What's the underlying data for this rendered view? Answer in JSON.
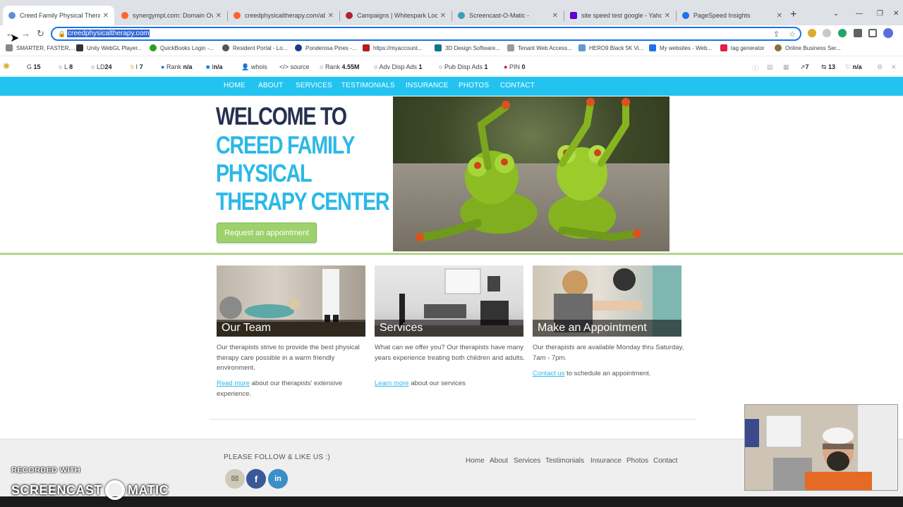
{
  "browser": {
    "tabs": [
      {
        "title": "Creed Family Physical Therapy C",
        "icon_color": "#5f8fd8",
        "active": true
      },
      {
        "title": "synergympt.com: Domain Overv",
        "icon_color": "#ff642d",
        "active": false
      },
      {
        "title": "creedphysicaltherapy.com/abou",
        "icon_color": "#ff642d",
        "active": false
      },
      {
        "title": "Campaigns | Whitespark Local C",
        "icon_color": "#b22234",
        "active": false
      },
      {
        "title": "Screencast-O-Matic -",
        "icon_color": "#3aa0b8",
        "active": false
      },
      {
        "title": "site speed test google - Yahoo S",
        "icon_color": "#6001d2",
        "active": false
      },
      {
        "title": "PageSpeed Insights",
        "icon_color": "#1a73e8",
        "active": false
      }
    ],
    "url": "creedphysicaltherapy.com",
    "bookmarks": [
      {
        "label": "SMARTER, FASTER,...",
        "color": "#888888"
      },
      {
        "label": "Unity WebGL Player...",
        "color": "#333333"
      },
      {
        "label": "QuickBooks Login -...",
        "color": "#2ca01c"
      },
      {
        "label": "Resident Portal - Lo...",
        "color": "#555555"
      },
      {
        "label": "Ponderosa Pines -...",
        "color": "#1e3a8a"
      },
      {
        "label": "https://myaccount...",
        "color": "#b91c1c"
      },
      {
        "label": "3D Design Software...",
        "color": "#0e7490"
      },
      {
        "label": "Tenant Web Access...",
        "color": "#999999"
      },
      {
        "label": "HERO9 Black 5K Vi...",
        "color": "#5b9bd5"
      },
      {
        "label": "My websites - Web...",
        "color": "#1a73e8"
      },
      {
        "label": "tag generator",
        "color": "#e11d48"
      },
      {
        "label": "Online Business Ser...",
        "color": "#8b6f3c"
      }
    ]
  },
  "seo_toolbar": [
    {
      "label": "G",
      "value": "15"
    },
    {
      "label": "L",
      "value": "8"
    },
    {
      "label": "LD",
      "value": "24"
    },
    {
      "label": "I",
      "value": "7"
    },
    {
      "label": "Rank",
      "value": "n/a"
    },
    {
      "label": "I",
      "value": "n/a"
    },
    {
      "label": "whois",
      "value": ""
    },
    {
      "label": "source",
      "value": ""
    },
    {
      "label": "Rank",
      "value": "4.55M"
    },
    {
      "label": "Adv Disp Ads",
      "value": "1"
    },
    {
      "label": "Pub Disp Ads",
      "value": "1"
    },
    {
      "label": "PIN",
      "value": "0"
    },
    {
      "label": "",
      "value": "7"
    },
    {
      "label": "",
      "value": "13"
    },
    {
      "label": "",
      "value": "n/a"
    }
  ],
  "site": {
    "nav": [
      "HOME",
      "ABOUT",
      "SERVICES",
      "TESTIMONIALS",
      "INSURANCE",
      "PHOTOS",
      "CONTACT"
    ],
    "hero": {
      "line1": "WELCOME TO",
      "line2": "CREED FAMILY",
      "line3": "PHYSICAL",
      "line4": "THERAPY CENTER",
      "button": "Request an appointment"
    },
    "cards": [
      {
        "caption": "Our Team",
        "text": "Our therapists strive to provide the best physical therapy care possible in a warm friendly environment.",
        "link": "Read more",
        "after_link": " about our therapists' extensive experience."
      },
      {
        "caption": "Services",
        "text": "What can we offer you? Our therapists have many years experience treating both children and adults.",
        "link": "Learn more",
        "after_link": " about our services"
      },
      {
        "caption": "Make an Appointment",
        "text": "Our therapists are available Monday thru Saturday, 7am - 7pm.",
        "link": "Contact us",
        "after_link": " to schedule an appointment."
      }
    ],
    "footer": {
      "follow": "PLEASE FOLLOW & LIKE US :)",
      "links": [
        "Home",
        "About",
        "Services",
        "Testimonials",
        "Insurance",
        "Photos",
        "Contact"
      ]
    }
  },
  "watermark": {
    "line1": "RECORDED WITH",
    "line2a": "SCREENCAST",
    "line2b": "MATIC"
  }
}
